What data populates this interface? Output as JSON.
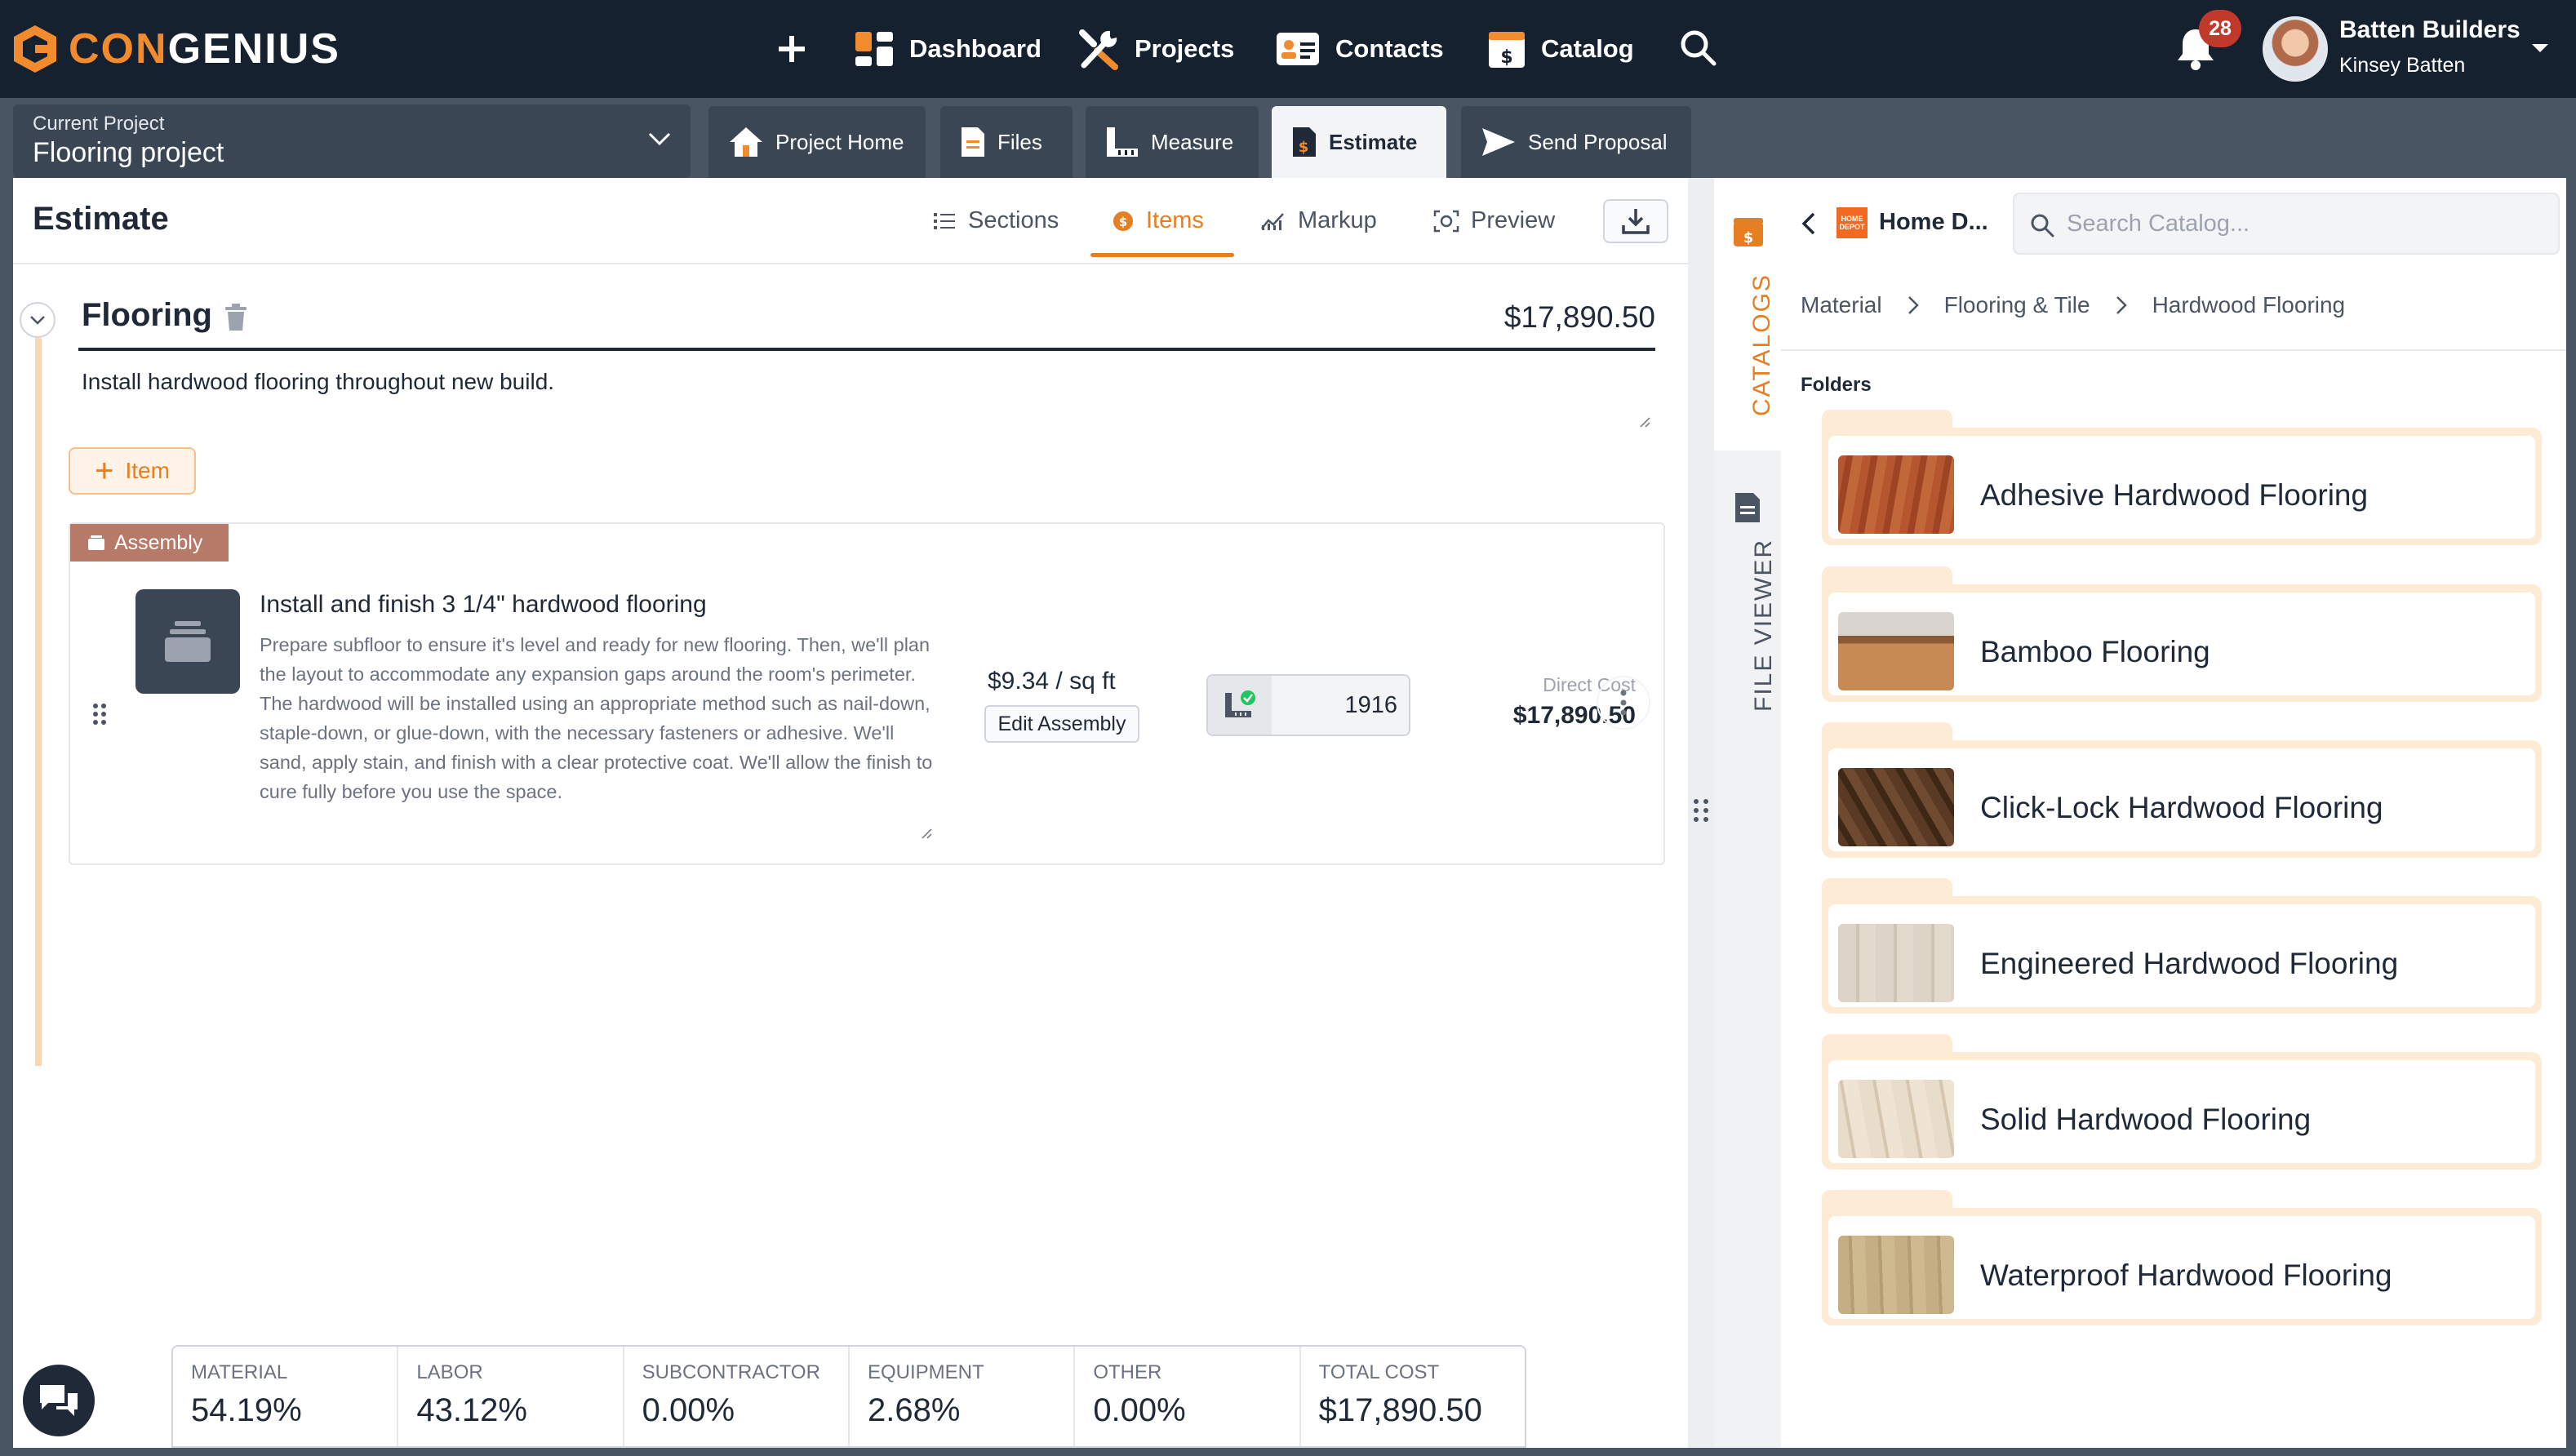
{
  "app": {
    "brand_part1": "CON",
    "brand_part2": "GENIUS",
    "nav": [
      "Dashboard",
      "Projects",
      "Contacts",
      "Catalog"
    ],
    "notifications": "28",
    "company": "Batten Builders",
    "user": "Kinsey Batten"
  },
  "project": {
    "label": "Current Project",
    "name": "Flooring project",
    "tabs": [
      "Project Home",
      "Files",
      "Measure",
      "Estimate",
      "Send Proposal"
    ],
    "active_tab": "Estimate"
  },
  "estimate": {
    "title": "Estimate",
    "tabs": [
      "Sections",
      "Items",
      "Markup",
      "Preview"
    ],
    "active_tab": "Items",
    "section": {
      "name": "Flooring",
      "total": "$17,890.50",
      "description": "Install hardwood flooring throughout new build.",
      "add_item_label": "Item"
    },
    "assembly": {
      "tag": "Assembly",
      "title": "Install and finish 3 1/4\" hardwood flooring",
      "description": "Prepare subfloor to ensure it's level and ready for new flooring. Then, we'll plan the layout to accommodate any expansion gaps around the room's perimeter. The hardwood will be installed using an appropriate method such as nail-down, staple-down, or glue-down, with the necessary fasteners or adhesive. We'll sand, apply stain, and finish with a clear protective coat. We'll allow the finish to cure fully before you use the space.",
      "price": "$9.34 / sq ft",
      "edit_label": "Edit Assembly",
      "quantity": "1916",
      "direct_cost_label": "Direct Cost",
      "direct_cost": "$17,890.50"
    },
    "summary": [
      {
        "label": "MATERIAL",
        "value": "54.19%"
      },
      {
        "label": "LABOR",
        "value": "43.12%"
      },
      {
        "label": "SUBCONTRACTOR",
        "value": "0.00%"
      },
      {
        "label": "EQUIPMENT",
        "value": "2.68%"
      },
      {
        "label": "OTHER",
        "value": "0.00%"
      },
      {
        "label": "TOTAL COST",
        "value": "$17,890.50"
      }
    ]
  },
  "side_tabs": {
    "catalogs": "CATALOGS",
    "file_viewer": "FILE VIEWER"
  },
  "catalog": {
    "store": "Home D...",
    "store_logo_text": "HOME DEPOT",
    "search_placeholder": "Search Catalog...",
    "breadcrumbs": [
      "Material",
      "Flooring & Tile",
      "Hardwood Flooring"
    ],
    "folders_label": "Folders",
    "folders": [
      "Adhesive Hardwood Flooring",
      "Bamboo Flooring",
      "Click-Lock Hardwood Flooring",
      "Engineered Hardwood Flooring",
      "Solid Hardwood Flooring",
      "Waterproof Hardwood Flooring"
    ]
  },
  "colors": {
    "accent": "#e67e22",
    "topbar": "#16212f",
    "tab_bg": "#3b4655",
    "folder": "#fdebd5"
  }
}
